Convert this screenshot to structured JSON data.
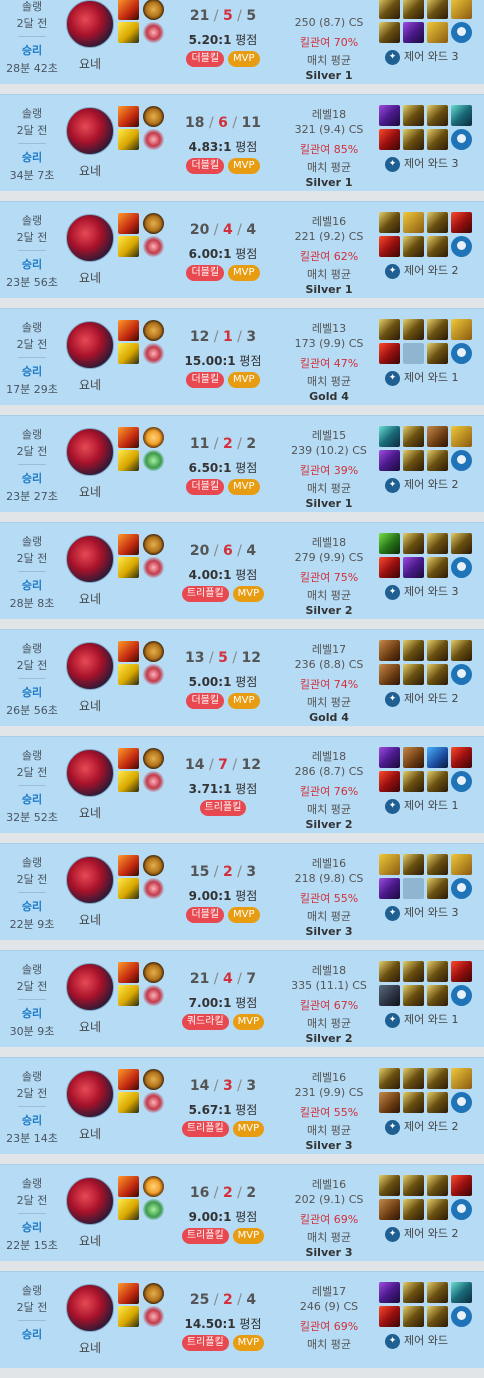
{
  "ui": {
    "ratio_suffix": "평점",
    "avg_label": "매치 평균",
    "mvp": "MVP",
    "ward_prefix": "제어 와드"
  },
  "games": [
    {
      "mode": "솔랭",
      "ago": "2달 전",
      "result": "승리",
      "duration": "28분 42초",
      "champion": "요네",
      "keystone": "conqueror",
      "secondary": "domination",
      "k": 21,
      "d": 5,
      "a": 5,
      "ratio": "5.20:1",
      "multikill": "더블킬",
      "mvp": true,
      "level": "",
      "cs": "250 (8.7) CS",
      "kp": "킬관여 70%",
      "tier": "Silver 1",
      "items": [
        "t-blade",
        "t-blade",
        "t-blade",
        "t-gold",
        "t-blade",
        "t-purple",
        "t-gold"
      ],
      "wards": "3"
    },
    {
      "mode": "솔랭",
      "ago": "2달 전",
      "result": "승리",
      "duration": "34분 7초",
      "champion": "요네",
      "keystone": "conqueror",
      "secondary": "domination",
      "k": 18,
      "d": 6,
      "a": 11,
      "ratio": "4.83:1",
      "multikill": "더블킬",
      "mvp": true,
      "level": "레벨18",
      "cs": "321 (9.4) CS",
      "kp": "킬관여 85%",
      "tier": "Silver 1",
      "items": [
        "t-purple",
        "t-blade",
        "t-blade",
        "t-teal",
        "t-red",
        "t-blade",
        "t-blade"
      ],
      "wards": "3"
    },
    {
      "mode": "솔랭",
      "ago": "2달 전",
      "result": "승리",
      "duration": "23분 56초",
      "champion": "요네",
      "keystone": "conqueror",
      "secondary": "domination",
      "k": 20,
      "d": 4,
      "a": 4,
      "ratio": "6.00:1",
      "multikill": "더블킬",
      "mvp": true,
      "level": "레벨16",
      "cs": "221 (9.2) CS",
      "kp": "킬관여 62%",
      "tier": "Silver 1",
      "items": [
        "t-blade",
        "t-gold",
        "t-blade",
        "t-red",
        "t-red",
        "t-blade",
        "t-blade"
      ],
      "wards": "2"
    },
    {
      "mode": "솔랭",
      "ago": "2달 전",
      "result": "승리",
      "duration": "17분 29초",
      "champion": "요네",
      "keystone": "conqueror",
      "secondary": "domination",
      "k": 12,
      "d": 1,
      "a": 3,
      "ratio": "15.00:1",
      "multikill": "더블킬",
      "mvp": true,
      "level": "레벨13",
      "cs": "173 (9.9) CS",
      "kp": "킬관여 47%",
      "tier": "Gold 4",
      "items": [
        "t-blade",
        "t-blade",
        "t-blade",
        "t-gold",
        "t-red",
        "t-empty",
        "t-blade"
      ],
      "wards": "1"
    },
    {
      "mode": "솔랭",
      "ago": "2달 전",
      "result": "승리",
      "duration": "23분 27초",
      "champion": "요네",
      "keystone": "electrocute",
      "secondary": "resolve",
      "k": 11,
      "d": 2,
      "a": 2,
      "ratio": "6.50:1",
      "multikill": "더블킬",
      "mvp": true,
      "level": "레벨15",
      "cs": "239 (10.2) CS",
      "kp": "킬관여 39%",
      "tier": "Silver 1",
      "items": [
        "t-teal",
        "t-blade",
        "t-brown",
        "t-gold",
        "t-purple",
        "t-blade",
        "t-blade"
      ],
      "wards": "2"
    },
    {
      "mode": "솔랭",
      "ago": "2달 전",
      "result": "승리",
      "duration": "28분 8초",
      "champion": "요네",
      "keystone": "conqueror",
      "secondary": "domination",
      "k": 20,
      "d": 6,
      "a": 4,
      "ratio": "4.00:1",
      "multikill": "트리플킬",
      "mvp": true,
      "level": "레벨18",
      "cs": "279 (9.9) CS",
      "kp": "킬관여 75%",
      "tier": "Silver 2",
      "items": [
        "t-green",
        "t-blade",
        "t-blade",
        "t-blade",
        "t-red",
        "t-purple",
        "t-blade"
      ],
      "wards": "3"
    },
    {
      "mode": "솔랭",
      "ago": "2달 전",
      "result": "승리",
      "duration": "26분 56초",
      "champion": "요네",
      "keystone": "conqueror",
      "secondary": "domination",
      "k": 13,
      "d": 5,
      "a": 12,
      "ratio": "5.00:1",
      "multikill": "더블킬",
      "mvp": true,
      "level": "레벨17",
      "cs": "236 (8.8) CS",
      "kp": "킬관여 74%",
      "tier": "Gold 4",
      "items": [
        "t-brown",
        "t-blade",
        "t-blade",
        "t-blade",
        "t-brown",
        "t-blade",
        "t-blade"
      ],
      "wards": "2"
    },
    {
      "mode": "솔랭",
      "ago": "2달 전",
      "result": "승리",
      "duration": "32분 52초",
      "champion": "요네",
      "keystone": "conqueror",
      "secondary": "domination",
      "k": 14,
      "d": 7,
      "a": 12,
      "ratio": "3.71:1",
      "multikill": "트리플킬",
      "mvp": false,
      "level": "레벨18",
      "cs": "286 (8.7) CS",
      "kp": "킬관여 76%",
      "tier": "Silver 2",
      "items": [
        "t-purple",
        "t-brown",
        "t-blue",
        "t-red",
        "t-red",
        "t-blade",
        "t-blade"
      ],
      "wards": "1"
    },
    {
      "mode": "솔랭",
      "ago": "2달 전",
      "result": "승리",
      "duration": "22분 9초",
      "champion": "요네",
      "keystone": "conqueror",
      "secondary": "domination",
      "k": 15,
      "d": 2,
      "a": 3,
      "ratio": "9.00:1",
      "multikill": "더블킬",
      "mvp": true,
      "level": "레벨16",
      "cs": "218 (9.8) CS",
      "kp": "킬관여 55%",
      "tier": "Silver 3",
      "items": [
        "t-gold",
        "t-blade",
        "t-blade",
        "t-gold",
        "t-purple",
        "t-empty",
        "t-blade"
      ],
      "wards": "3"
    },
    {
      "mode": "솔랭",
      "ago": "2달 전",
      "result": "승리",
      "duration": "30분 9초",
      "champion": "요네",
      "keystone": "conqueror",
      "secondary": "domination",
      "k": 21,
      "d": 4,
      "a": 7,
      "ratio": "7.00:1",
      "multikill": "쿼드라킬",
      "mvp": true,
      "level": "레벨18",
      "cs": "335 (11.1) CS",
      "kp": "킬관여 67%",
      "tier": "Silver 2",
      "items": [
        "t-blade",
        "t-blade",
        "t-blade",
        "t-red",
        "t-dark",
        "t-blade",
        "t-blade"
      ],
      "wards": "1"
    },
    {
      "mode": "솔랭",
      "ago": "2달 전",
      "result": "승리",
      "duration": "23분 14초",
      "champion": "요네",
      "keystone": "conqueror",
      "secondary": "domination",
      "k": 14,
      "d": 3,
      "a": 3,
      "ratio": "5.67:1",
      "multikill": "트리플킬",
      "mvp": true,
      "level": "레벨16",
      "cs": "231 (9.9) CS",
      "kp": "킬관여 55%",
      "tier": "Silver 3",
      "items": [
        "t-blade",
        "t-blade",
        "t-blade",
        "t-gold",
        "t-brown",
        "t-blade",
        "t-blade"
      ],
      "wards": "2"
    },
    {
      "mode": "솔랭",
      "ago": "2달 전",
      "result": "승리",
      "duration": "22분 15초",
      "champion": "요네",
      "keystone": "electrocute",
      "secondary": "resolve",
      "k": 16,
      "d": 2,
      "a": 2,
      "ratio": "9.00:1",
      "multikill": "트리플킬",
      "mvp": true,
      "level": "레벨16",
      "cs": "202 (9.1) CS",
      "kp": "킬관여 69%",
      "tier": "Silver 3",
      "items": [
        "t-blade",
        "t-blade",
        "t-blade",
        "t-red",
        "t-brown",
        "t-blade",
        "t-blade"
      ],
      "wards": "2"
    },
    {
      "mode": "솔랭",
      "ago": "2달 전",
      "result": "승리",
      "duration": "",
      "champion": "요네",
      "keystone": "conqueror",
      "secondary": "domination",
      "k": 25,
      "d": 2,
      "a": 4,
      "ratio": "14.50:1",
      "multikill": "트리플킬",
      "mvp": true,
      "level": "레벨17",
      "cs": "246 (9) CS",
      "kp": "킬관여 69%",
      "tier": "",
      "items": [
        "t-purple",
        "t-blade",
        "t-blade",
        "t-teal",
        "t-red",
        "t-blade",
        "t-blade"
      ],
      "wards": ""
    }
  ]
}
